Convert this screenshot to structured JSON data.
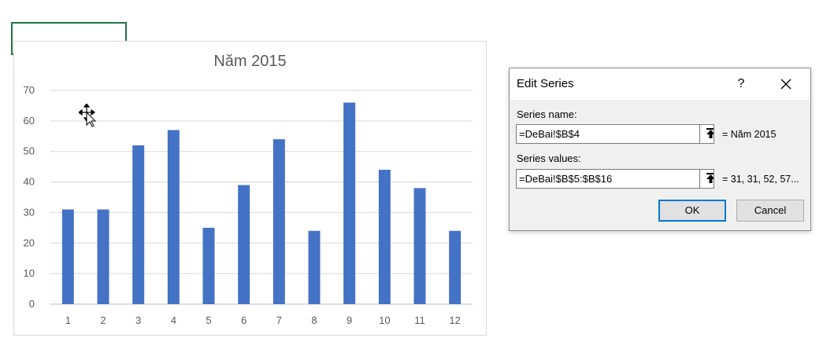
{
  "chart_data": {
    "type": "bar",
    "title": "Năm 2015",
    "categories": [
      "1",
      "2",
      "3",
      "4",
      "5",
      "6",
      "7",
      "8",
      "9",
      "10",
      "11",
      "12"
    ],
    "values": [
      31,
      31,
      52,
      57,
      25,
      39,
      54,
      24,
      66,
      44,
      38,
      24
    ],
    "y_ticks": [
      "0",
      "10",
      "20",
      "30",
      "40",
      "50",
      "60",
      "70"
    ],
    "ylim": [
      0,
      70
    ],
    "xlabel": "",
    "ylabel": "",
    "grid": true,
    "bar_color": "#4472c4"
  },
  "dialog": {
    "title": "Edit Series",
    "help_label": "?",
    "series_name_label": "Series name:",
    "series_name_value": "=DeBai!$B$4",
    "series_name_preview": "= Năm 2015",
    "series_values_label": "Series values:",
    "series_values_value": "=DeBai!$B$5:$B$16",
    "series_values_preview": "= 31, 31, 52, 57...",
    "ok_label": "OK",
    "cancel_label": "Cancel",
    "accent_color": "#0078d7"
  },
  "icons": {
    "move_cursor": "move-cursor-icon",
    "close": "close-icon",
    "collapse": "collapse-dialog-icon"
  }
}
